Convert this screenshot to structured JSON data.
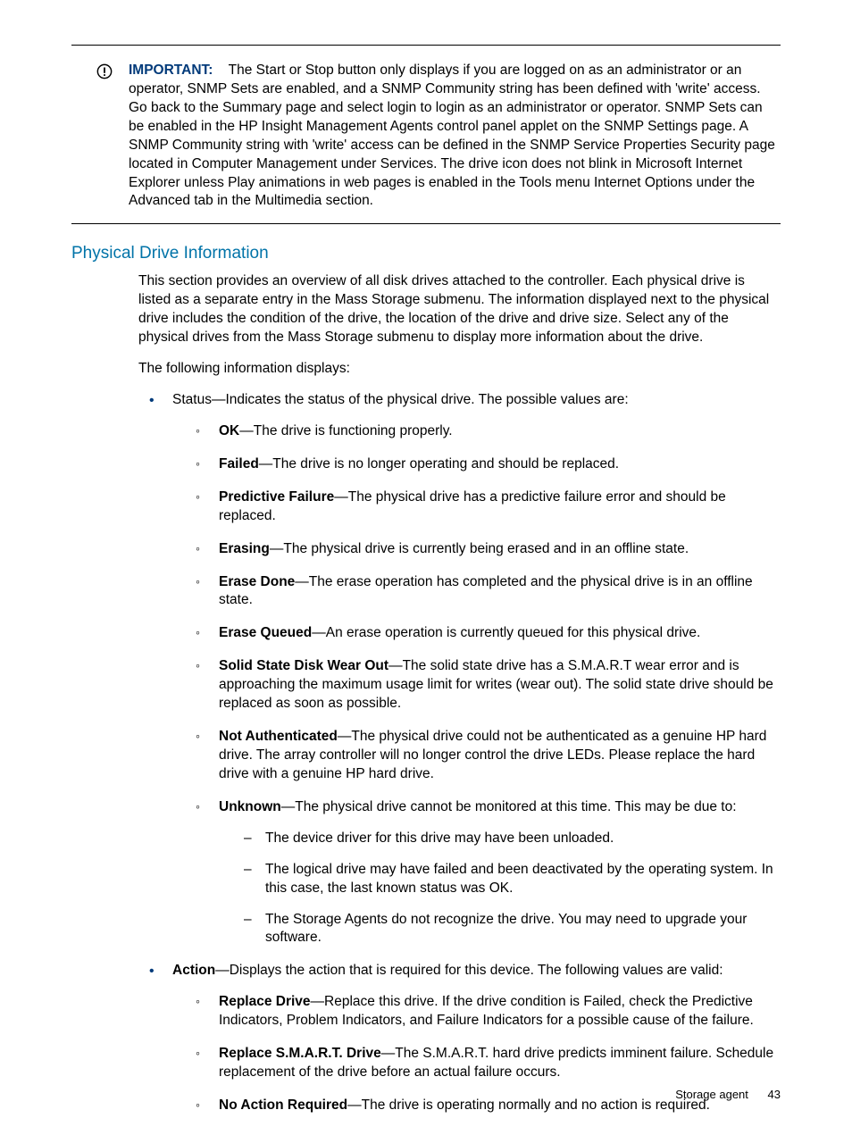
{
  "note": {
    "label": "IMPORTANT:",
    "text": "The Start or Stop button only displays if you are logged on as an administrator or an operator, SNMP Sets are enabled, and a SNMP Community string has been defined with 'write' access. Go back to the Summary page and select login to login as an administrator or operator. SNMP Sets can be enabled in the HP Insight Management Agents control panel applet on the SNMP Settings page. A SNMP Community string with 'write' access can be defined in the SNMP Service Properties Security page located in Computer Management under Services. The drive icon does not blink in Microsoft Internet Explorer unless Play animations in web pages is enabled in the Tools menu Internet Options under the Advanced tab in the Multimedia section."
  },
  "section": {
    "heading": "Physical Drive Information",
    "intro1": "This section provides an overview of all disk drives attached to the controller. Each physical drive is listed as a separate entry in the Mass Storage submenu. The information displayed next to the physical drive includes the condition of the drive, the location of the drive and drive size. Select any of the physical drives from the Mass Storage submenu to display more information about the drive.",
    "intro2": "The following information displays:"
  },
  "status": {
    "lead": "Status—Indicates the status of the physical drive. The possible values are:",
    "items": [
      {
        "term": "OK",
        "desc": "—The drive is functioning properly."
      },
      {
        "term": "Failed",
        "desc": "—The drive is no longer operating and should be replaced."
      },
      {
        "term": "Predictive Failure",
        "desc": "—The physical drive has a predictive failure error and should be replaced."
      },
      {
        "term": "Erasing",
        "desc": "—The physical drive is currently being erased and in an offline state."
      },
      {
        "term": "Erase Done",
        "desc": "—The erase operation has completed and the physical drive is in an offline state."
      },
      {
        "term": "Erase Queued",
        "desc": "—An erase operation is currently queued for this physical drive."
      },
      {
        "term": "Solid State Disk Wear Out",
        "desc": "—The solid state drive has a S.M.A.R.T wear error and is approaching the maximum usage limit for writes (wear out). The solid state drive should be replaced as soon as possible."
      },
      {
        "term": "Not Authenticated",
        "desc": "—The physical drive could not be authenticated as a genuine HP hard drive. The array controller will no longer control the drive LEDs. Please replace the hard drive with a genuine HP hard drive."
      },
      {
        "term": "Unknown",
        "desc": "—The physical drive cannot be monitored at this time. This may be due to:"
      }
    ],
    "unknown_sub": [
      "The device driver for this drive may have been unloaded.",
      "The logical drive may have failed and been deactivated by the operating system. In this case, the last known status was OK.",
      "The Storage Agents do not recognize the drive. You may need to upgrade your software."
    ]
  },
  "action": {
    "lead_term": "Action",
    "lead_desc": "—Displays the action that is required for this device. The following values are valid:",
    "items": [
      {
        "term": "Replace Drive",
        "desc": "—Replace this drive. If the drive condition is Failed, check the Predictive Indicators, Problem Indicators, and Failure Indicators for a possible cause of the failure."
      },
      {
        "term": "Replace S.M.A.R.T. Drive",
        "desc": "—The S.M.A.R.T. hard drive predicts imminent failure. Schedule replacement of the drive before an actual failure occurs."
      },
      {
        "term": "No Action Required",
        "desc": "—The drive is operating normally and no action is required."
      }
    ]
  },
  "footer": {
    "section": "Storage agent",
    "page": "43"
  }
}
